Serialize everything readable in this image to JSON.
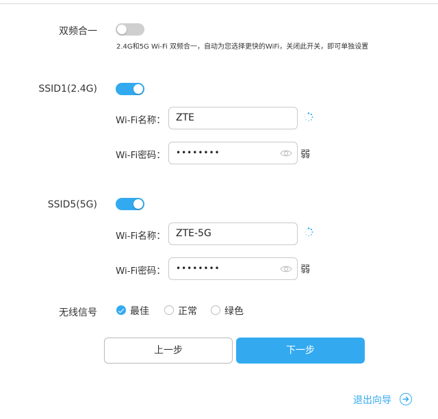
{
  "dual_band": {
    "label": "双频合一",
    "enabled": false,
    "hint": "2.4G和5G Wi-Fi 双频合一，自动为您选择更快的WiFi，关闭此开关，即可单独设置"
  },
  "ssid1": {
    "label": "SSID1(2.4G)",
    "enabled": true,
    "name_label": "Wi-Fi名称：",
    "name_value": "ZTE",
    "pwd_label": "Wi-Fi密码：",
    "pwd_value": "••••••••",
    "strength": "弱"
  },
  "ssid5": {
    "label": "SSID5(5G)",
    "enabled": true,
    "name_label": "Wi-Fi名称：",
    "name_value": "ZTE-5G",
    "pwd_label": "Wi-Fi密码：",
    "pwd_value": "••••••••",
    "strength": "弱"
  },
  "signal": {
    "label": "无线信号",
    "options": [
      {
        "label": "最佳",
        "selected": true
      },
      {
        "label": "正常",
        "selected": false
      },
      {
        "label": "绿色",
        "selected": false
      }
    ]
  },
  "buttons": {
    "prev_label": "上一步",
    "next_label": "下一步"
  },
  "exit_label": "退出向导",
  "colors": {
    "accent": "#33aaf0",
    "toggle_off": "#cfcfcf"
  },
  "icons": {
    "loading": "spinner-icon",
    "eye": "eye-icon",
    "exit": "arrow-right-circle-icon"
  }
}
